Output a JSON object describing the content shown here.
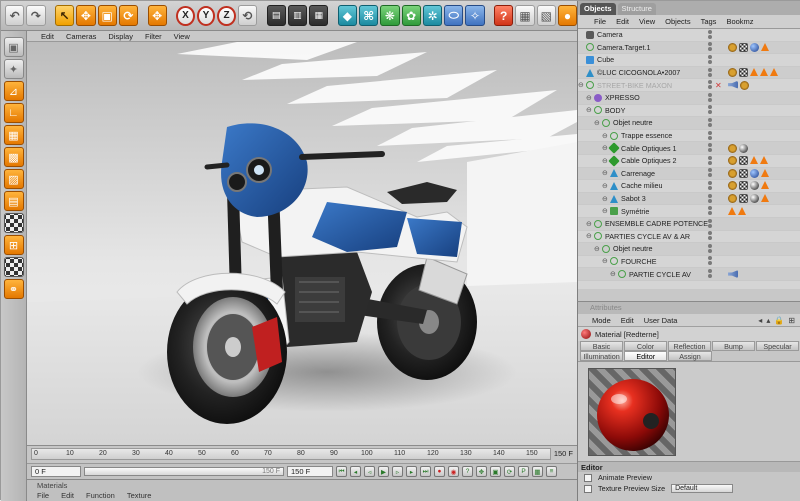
{
  "viewport_menu": [
    "Edit",
    "Cameras",
    "Display",
    "Filter",
    "View"
  ],
  "timeline": {
    "ticks": [
      "0",
      "10",
      "20",
      "30",
      "40",
      "50",
      "60",
      "70",
      "80",
      "90",
      "100",
      "110",
      "120",
      "130",
      "140",
      "150"
    ],
    "end_frame_label": "150 F"
  },
  "transport": {
    "current_frame": "0 F",
    "slider_value": "150 F",
    "end_frame": "150 F"
  },
  "materials": {
    "title": "Materials",
    "menu": [
      "File",
      "Edit",
      "Function",
      "Texture"
    ]
  },
  "object_manager": {
    "tabs": [
      "Objects",
      "Structure"
    ],
    "menu": [
      "File",
      "Edit",
      "View",
      "Objects",
      "Tags",
      "Bookmz"
    ],
    "rows": [
      {
        "name": "Camera",
        "indent": 0,
        "icon": "cam",
        "tags": []
      },
      {
        "name": "Camera.Target.1",
        "indent": 0,
        "icon": "null",
        "tags": [
          "gear",
          "chk",
          "blu",
          "ora"
        ]
      },
      {
        "name": "Cube",
        "indent": 0,
        "icon": "cube",
        "tags": []
      },
      {
        "name": "©LUC CICOGNOLA•2007",
        "indent": 0,
        "icon": "tri",
        "tags": [
          "gear",
          "chk",
          "ora",
          "ora",
          "ora"
        ]
      },
      {
        "name": "STREET-BIKE MAXON",
        "indent": 0,
        "icon": "null",
        "dim": true,
        "tags": [
          "snd",
          "gear"
        ]
      },
      {
        "name": "XPRESSO",
        "indent": 1,
        "icon": "purple",
        "tags": []
      },
      {
        "name": "BODY",
        "indent": 1,
        "icon": "null",
        "tags": []
      },
      {
        "name": "Objet neutre",
        "indent": 2,
        "icon": "null",
        "tags": []
      },
      {
        "name": "Trappe essence",
        "indent": 3,
        "icon": "null",
        "tags": []
      },
      {
        "name": "Cable Optiques 1",
        "indent": 3,
        "icon": "cable",
        "tags": [
          "gear",
          "ball"
        ]
      },
      {
        "name": "Cable Optiques 2",
        "indent": 3,
        "icon": "cable",
        "tags": [
          "gear",
          "chk",
          "ora",
          "ora"
        ]
      },
      {
        "name": "Carrenage",
        "indent": 3,
        "icon": "tri",
        "tags": [
          "gear",
          "chk",
          "blu",
          "ora"
        ]
      },
      {
        "name": "Cache milieu",
        "indent": 3,
        "icon": "tri",
        "tags": [
          "gear",
          "chk",
          "ball",
          "ora"
        ]
      },
      {
        "name": "Sabot 3",
        "indent": 3,
        "icon": "tri",
        "tags": [
          "gear",
          "chk",
          "ball",
          "ora"
        ]
      },
      {
        "name": "Symétrie",
        "indent": 3,
        "icon": "sym",
        "tags": [
          "ora",
          "ora"
        ]
      },
      {
        "name": "ENSEMBLE CADRE POTENCE",
        "indent": 1,
        "icon": "null",
        "tags": []
      },
      {
        "name": "PARTIES CYCLE AV & AR",
        "indent": 1,
        "icon": "null",
        "tags": []
      },
      {
        "name": "Objet neutre",
        "indent": 2,
        "icon": "null",
        "tags": []
      },
      {
        "name": "FOURCHE",
        "indent": 3,
        "icon": "null",
        "tags": []
      },
      {
        "name": "PARTIE CYCLE AV",
        "indent": 4,
        "icon": "null",
        "tags": [
          "snd"
        ]
      }
    ]
  },
  "attributes": {
    "title": "Attributes",
    "menu": [
      "Mode",
      "Edit",
      "User Data"
    ],
    "material_name": "Material [Redterne]",
    "channels_row1": [
      "Basic",
      "Color",
      "Reflection",
      "Bump",
      "Specular"
    ],
    "channels_row2": [
      "Illumination",
      "Editor",
      "Assign"
    ],
    "active_channel": "Editor",
    "section": "Editor",
    "options": [
      {
        "label": "Animate Preview",
        "type": "checkbox"
      },
      {
        "label": "Texture Preview Size",
        "type": "dropdown",
        "value": "Default"
      }
    ]
  }
}
